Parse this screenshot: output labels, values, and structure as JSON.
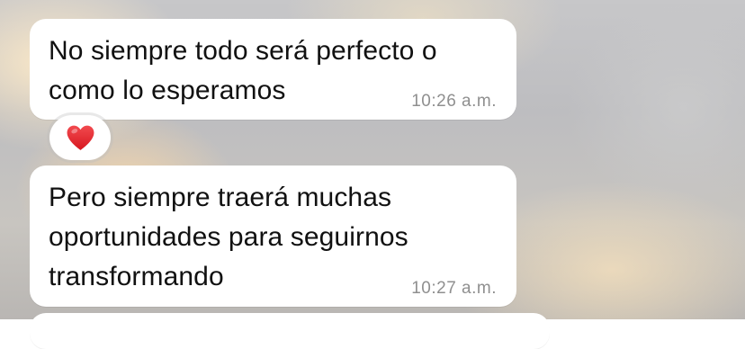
{
  "chat": {
    "messages": [
      {
        "lines": [
          "No siempre todo será perfecto o",
          "como lo esperamos"
        ],
        "time": "10:26 a.m.",
        "reaction": "heart-icon"
      },
      {
        "lines": [
          "Pero siempre traerá muchas",
          "oportunidades para seguirnos",
          "transformando"
        ],
        "time": "10:27 a.m."
      }
    ]
  },
  "colors": {
    "bubble_background": "#ffffff",
    "message_text": "#111111",
    "timestamp_text": "#8f8f8f",
    "reaction_heart": "#e0212b"
  }
}
